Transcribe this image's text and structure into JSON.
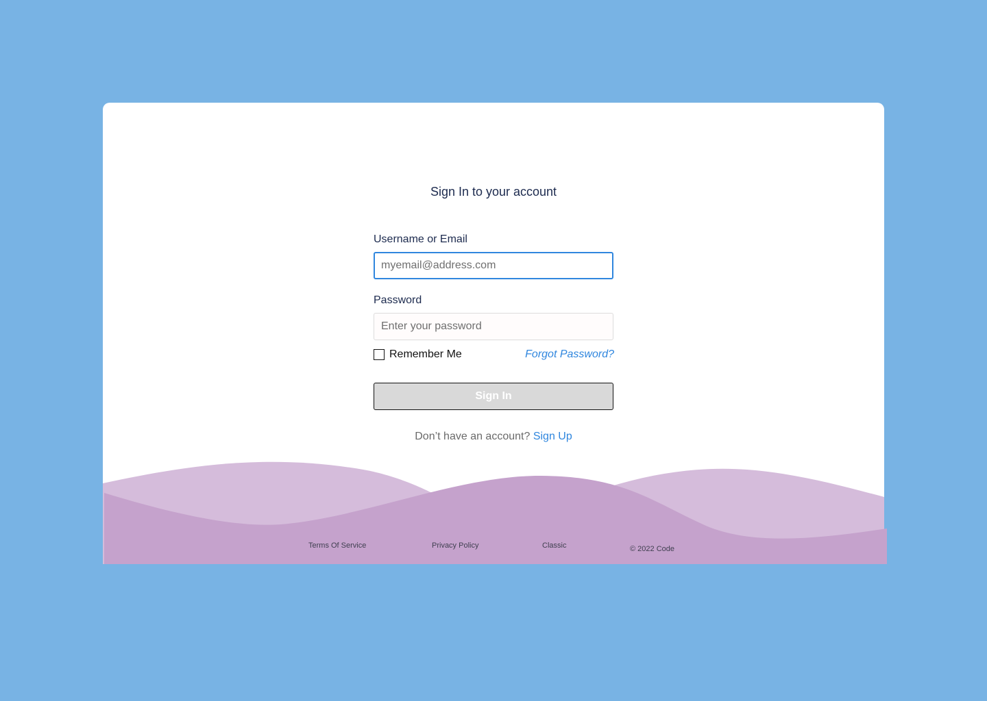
{
  "colors": {
    "background": "#78b3e4",
    "card": "#ffffff",
    "accent": "#2f86de",
    "wave_light": "#d5bcdb",
    "wave_dark": "#c5a2cc",
    "button_bg": "#d9d9d9"
  },
  "signin": {
    "title": "Sign In to your account",
    "username_label": "Username or Email",
    "username_placeholder": "myemail@address.com",
    "password_label": "Password",
    "password_placeholder": "Enter your password",
    "remember_label": "Remember Me",
    "forgot_label": "Forgot Password?",
    "submit_label": "Sign In",
    "no_account_text": "Don’t have an account?",
    "signup_label": "Sign Up"
  },
  "footer": {
    "terms": "Terms Of Service",
    "privacy": "Privacy Policy",
    "classic": "Classic",
    "copyright": "© 2022 Code"
  }
}
